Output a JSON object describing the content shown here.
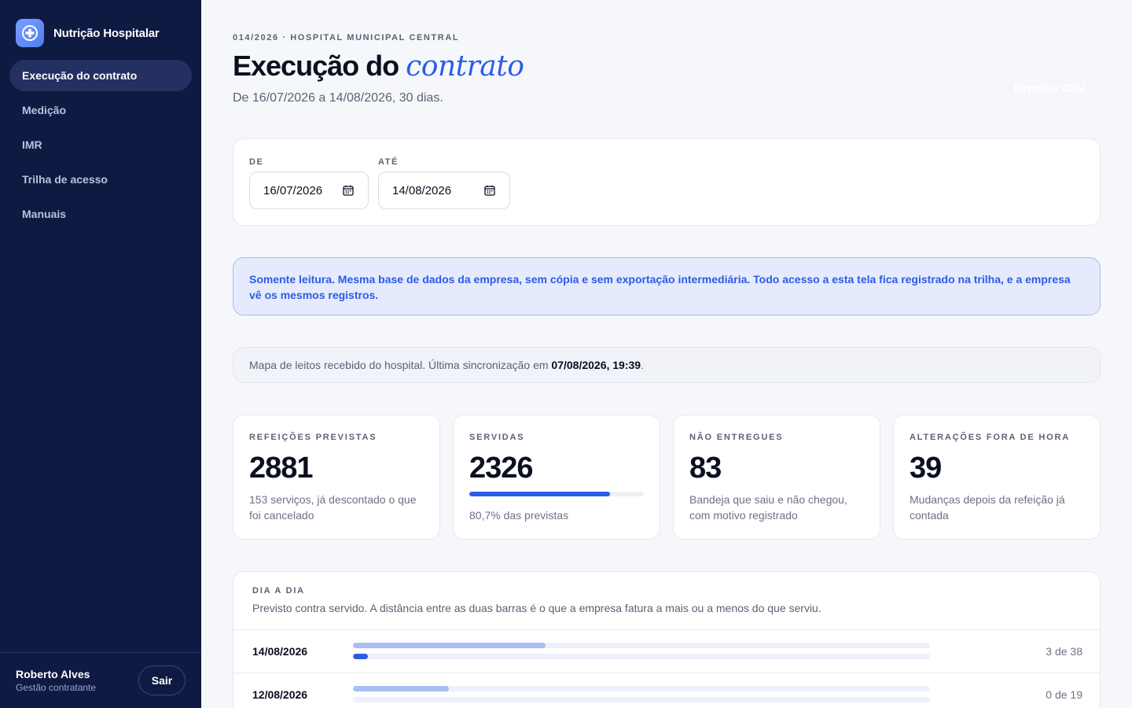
{
  "sidebar": {
    "brand": "Nutrição Hospitalar",
    "logo_icon": "medical-cross-icon",
    "items": [
      {
        "label": "Execução do contrato",
        "active": true
      },
      {
        "label": "Medição",
        "active": false
      },
      {
        "label": "IMR",
        "active": false
      },
      {
        "label": "Trilha de acesso",
        "active": false
      },
      {
        "label": "Manuais",
        "active": false
      }
    ],
    "user": {
      "name": "Roberto Alves",
      "role": "Gestão contratante",
      "logout_label": "Sair"
    }
  },
  "header": {
    "eyebrow": "014/2026 · HOSPITAL MUNICIPAL CENTRAL",
    "title_main": "Execução do",
    "title_accent": "contrato",
    "subtitle": "De 16/07/2026 a 14/08/2026, 30 dias.",
    "export_label": "Exportar CSV"
  },
  "filters": {
    "from_label": "DE",
    "from_value": "16/07/2026",
    "to_label": "ATÉ",
    "to_value": "14/08/2026"
  },
  "notice": "Somente leitura. Mesma base de dados da empresa, sem cópia e sem exportação intermediária. Todo acesso a esta tela fica registrado na trilha, e a empresa vê os mesmos registros.",
  "sync": {
    "text": "Mapa de leitos recebido do hospital. Última sincronização em",
    "timestamp": "07/08/2026, 19:39",
    "suffix": "."
  },
  "stats": [
    {
      "label": "REFEIÇÕES PREVISTAS",
      "value": "2881",
      "desc": "153 serviços, já descontado o que foi cancelado"
    },
    {
      "label": "SERVIDAS",
      "value": "2326",
      "desc": "80,7% das previstas",
      "progress": 0.807
    },
    {
      "label": "NÃO ENTREGUES",
      "value": "83",
      "desc": "Bandeja que saiu e não chegou, com motivo registrado"
    },
    {
      "label": "ALTERAÇÕES FORA DE HORA",
      "value": "39",
      "desc": "Mudanças depois da refeição já contada"
    }
  ],
  "daily": {
    "label": "DIA A DIA",
    "desc": "Previsto contra servido. A distância entre as duas barras é o que a empresa fatura a mais ou a menos do que serviu.",
    "max": 114,
    "rows": [
      {
        "date": "14/08/2026",
        "served": 3,
        "planned": 38,
        "count_label": "3 de 38"
      },
      {
        "date": "12/08/2026",
        "served": 0,
        "planned": 19,
        "count_label": "0 de 19"
      }
    ]
  },
  "colors": {
    "sidebar": "#0f1a43",
    "accent": "#2c5be8",
    "accent_light": "#a9bdf5",
    "notice_bg": "#e5ebfd"
  }
}
